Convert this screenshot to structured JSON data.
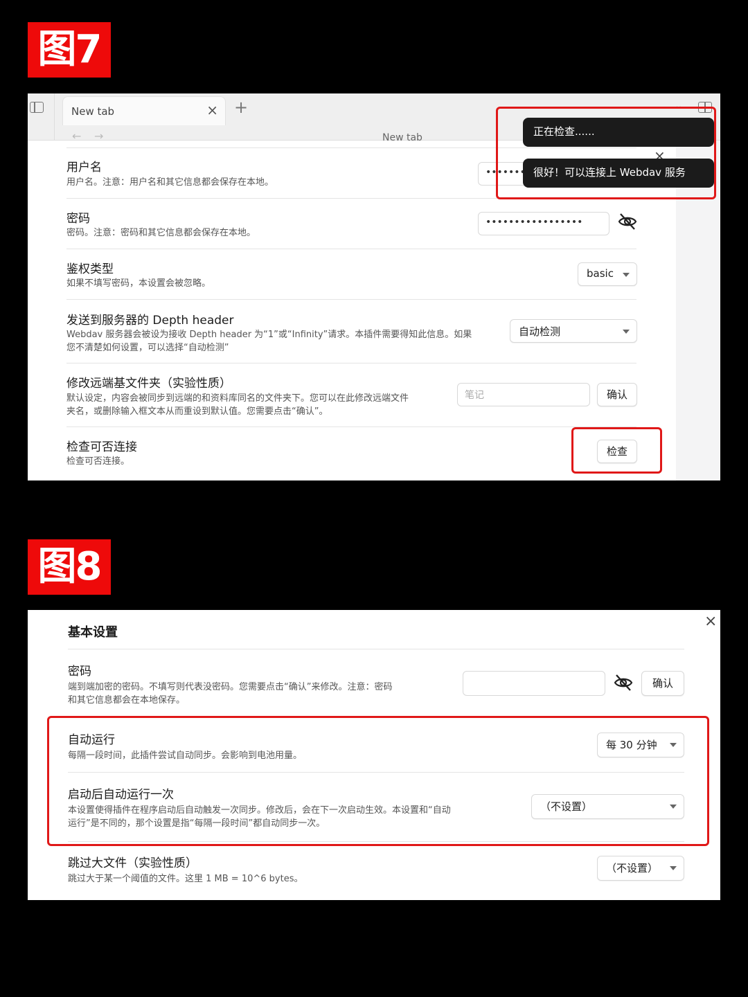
{
  "figure7": {
    "label": "图7",
    "tab": {
      "title": "New tab",
      "close": "×",
      "add": "+"
    },
    "nav": {
      "back": "←",
      "forward": "→",
      "address_title": "New tab"
    },
    "toasts": [
      "正在检查......",
      "很好！可以连接上 Webdav 服务器。"
    ],
    "modal_close": "×",
    "settings": {
      "username": {
        "title": "用户名",
        "desc": "用户名。注意：用户名和其它信息都会保存在本地。",
        "value": "•••••••"
      },
      "password": {
        "title": "密码",
        "desc": "密码。注意：密码和其它信息都会保存在本地。",
        "value": "•••••••••••••••••",
        "icon": "eye-off-icon"
      },
      "auth_type": {
        "title": "鉴权类型",
        "desc": "如果不填写密码，本设置会被忽略。",
        "selected": "basic"
      },
      "depth_header": {
        "title": "发送到服务器的 Depth header",
        "desc_line1": "Webdav 服务器会被设为接收 Depth header 为“1”或“Infinity”请求。本插件需要得知此信息。如果",
        "desc_line2": "您不清楚如何设置，可以选择“自动检测”",
        "selected": "自动检测"
      },
      "remote_folder": {
        "title": "修改远端基文件夹（实验性质）",
        "desc_line1": "默认设定，内容会被同步到远端的和资料库同名的文件夹下。您可以在此修改远端文件",
        "desc_line2": "夹名，或删除输入框文本从而重设到默认值。您需要点击“确认”。",
        "placeholder": "笔记",
        "button": "确认"
      },
      "check_connect": {
        "title": "检查可否连接",
        "desc": "检查可否连接。",
        "button": "检查"
      }
    },
    "highlight_color": "#e01818"
  },
  "figure8": {
    "label": "图8",
    "close": "×",
    "section": "基本设置",
    "settings": {
      "password": {
        "title": "密码",
        "desc_line1": "端到端加密的密码。不填写则代表没密码。您需要点击“确认”来修改。注意：密码",
        "desc_line2": "和其它信息都会在本地保存。",
        "value": "",
        "icon": "eye-off-icon",
        "button": "确认"
      },
      "auto_run": {
        "title": "自动运行",
        "desc": "每隔一段时间，此插件尝试自动同步。会影响到电池用量。",
        "selected": "每 30 分钟"
      },
      "run_once_on_start": {
        "title": "启动后自动运行一次",
        "desc_line1": "本设置使得插件在程序启动后自动触发一次同步。修改后，会在下一次启动生效。本设置和“自动",
        "desc_line2": "运行”是不同的，那个设置是指“每隔一段时间”都自动同步一次。",
        "selected": "（不设置）"
      },
      "skip_large": {
        "title": "跳过大文件（实验性质）",
        "desc": "跳过大于某一个阈值的文件。这里 1 MB = 10^6 bytes。",
        "selected": "（不设置）"
      }
    }
  }
}
